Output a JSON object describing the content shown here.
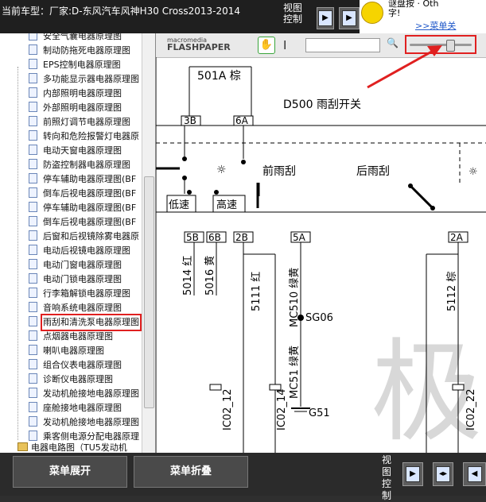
{
  "header": {
    "title": "当前车型：厂家:D-东风汽车风神H30 Cross2013-2014",
    "view_control_label": "视图控制"
  },
  "ad": {
    "line1": "谜盘按 · Oth",
    "line2": "字!",
    "link": ">>菜单关"
  },
  "sidebar": {
    "items": [
      "安全气囊电器原理图",
      "制动防拖死电器原理图",
      "EPS控制电器原理图",
      "多功能显示器电器原理图",
      "内部照明电器原理图",
      "外部照明电器原理图",
      "前照灯调节电器原理图",
      "转向和危险报警灯电器原",
      "电动天窗电器原理图",
      "防盗控制器电器原理图",
      "停车辅助电器原理图(BF",
      "倒车后视电器原理图(BF",
      "停车辅助电器原理图(BF",
      "倒车后视电器原理图(BF",
      "后窗和后视镜除雾电器原",
      "电动后视镜电器原理图",
      "电动门窗电器原理图",
      "电动门锁电器原理图",
      "行李箱解锁电器原理图",
      "音响系统电器原理图",
      "雨刮和清洗泵电器原理图",
      "点烟器电器原理图",
      "喇叭电器原理图",
      "组合仪表电器原理图",
      "诊断仪电器原理图",
      "发动机舱接地电器原理图",
      "座舱接地电器原理图",
      "发动机舱接地电器原理图",
      "乘客侧电源分配电器原理"
    ],
    "selected_index": 20,
    "folder": "电器电路图（TU5发动机"
  },
  "viewer": {
    "brand_top": "macromedia",
    "brand_bottom": "FLASHPAPER",
    "zoom_level": 0.65
  },
  "schematic": {
    "title": "D500 雨刮开关",
    "connector_top": "501A 棕",
    "pins_top": [
      "3B",
      "6A"
    ],
    "front_wiper": "前雨刮",
    "rear_wiper": "后雨刮",
    "speed_low": "低速",
    "speed_high": "高速",
    "pins_bottom": [
      "5B",
      "6B",
      "2B",
      "5A",
      "2A"
    ],
    "wires": [
      "5014 红",
      "5016 黄",
      "5111 红",
      "MC510 绿黄",
      "5112 棕"
    ],
    "splice": "SG06",
    "ground_wire": "MC51 绿黄",
    "ground": "G51",
    "connectors": [
      "IC02_12",
      "IC02_14",
      "IC02_22"
    ]
  },
  "footer": {
    "expand_button": "菜单展开",
    "collapse_button": "菜单折叠",
    "view_control_label": "视图控制"
  }
}
